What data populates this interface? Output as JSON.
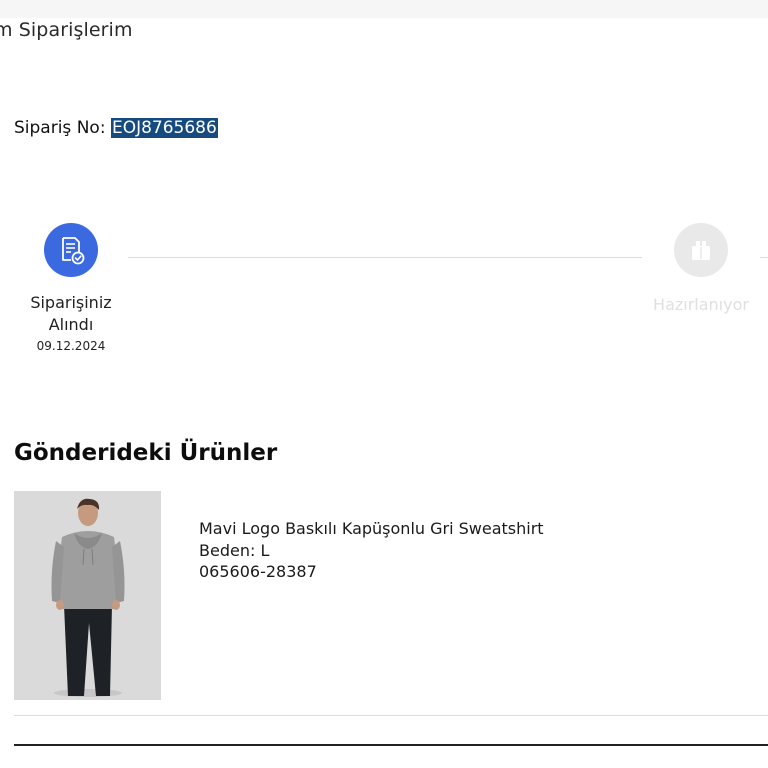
{
  "header": {
    "breadcrumb": "m Siparişlerim"
  },
  "order": {
    "label": "Sipariş No:",
    "number": "EOJ8765686"
  },
  "tracker": {
    "steps": [
      {
        "label_line1": "Siparişiniz",
        "label_line2": "Alındı",
        "date": "09.12.2024",
        "state": "completed",
        "icon": "order-received-icon"
      },
      {
        "label_line1": "Hazırlanıyor",
        "label_line2": "",
        "date": "",
        "state": "pending",
        "icon": "preparing-package-icon"
      }
    ]
  },
  "products_section": {
    "title": "Gönderideki Ürünler"
  },
  "products": [
    {
      "name": "Mavi Logo Baskılı Kapüşonlu Gri Sweatshirt",
      "size": "Beden: L",
      "code": "065606-28387",
      "image": "product-photo-gray-hoodie"
    }
  ],
  "colors": {
    "accent": "#3b6ae0",
    "selection": "#174a7e",
    "inactive": "#e9e9e9",
    "muted_text": "#e0e0e0"
  }
}
